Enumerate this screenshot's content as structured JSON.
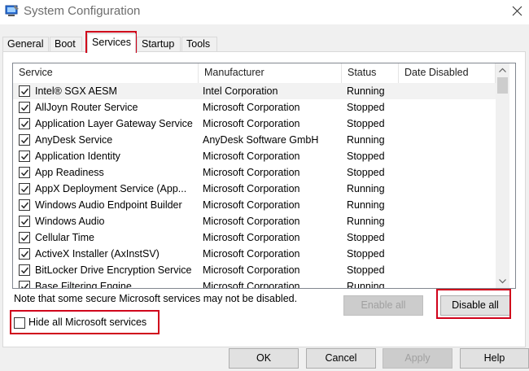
{
  "window": {
    "title": "System Configuration"
  },
  "tabs": [
    {
      "label": "General"
    },
    {
      "label": "Boot"
    },
    {
      "label": "Services",
      "selected": true
    },
    {
      "label": "Startup"
    },
    {
      "label": "Tools"
    }
  ],
  "list": {
    "columns": [
      "Service",
      "Manufacturer",
      "Status",
      "Date Disabled"
    ],
    "rows": [
      {
        "service": "Intel® SGX AESM",
        "manufacturer": "Intel Corporation",
        "status": "Running",
        "date_disabled": "",
        "checked": true
      },
      {
        "service": "AllJoyn Router Service",
        "manufacturer": "Microsoft Corporation",
        "status": "Stopped",
        "date_disabled": "",
        "checked": true
      },
      {
        "service": "Application Layer Gateway Service",
        "manufacturer": "Microsoft Corporation",
        "status": "Stopped",
        "date_disabled": "",
        "checked": true
      },
      {
        "service": "AnyDesk Service",
        "manufacturer": "AnyDesk Software GmbH",
        "status": "Running",
        "date_disabled": "",
        "checked": true
      },
      {
        "service": "Application Identity",
        "manufacturer": "Microsoft Corporation",
        "status": "Stopped",
        "date_disabled": "",
        "checked": true
      },
      {
        "service": "App Readiness",
        "manufacturer": "Microsoft Corporation",
        "status": "Stopped",
        "date_disabled": "",
        "checked": true
      },
      {
        "service": "AppX Deployment Service (App...",
        "manufacturer": "Microsoft Corporation",
        "status": "Running",
        "date_disabled": "",
        "checked": true
      },
      {
        "service": "Windows Audio Endpoint Builder",
        "manufacturer": "Microsoft Corporation",
        "status": "Running",
        "date_disabled": "",
        "checked": true
      },
      {
        "service": "Windows Audio",
        "manufacturer": "Microsoft Corporation",
        "status": "Running",
        "date_disabled": "",
        "checked": true
      },
      {
        "service": "Cellular Time",
        "manufacturer": "Microsoft Corporation",
        "status": "Stopped",
        "date_disabled": "",
        "checked": true
      },
      {
        "service": "ActiveX Installer (AxInstSV)",
        "manufacturer": "Microsoft Corporation",
        "status": "Stopped",
        "date_disabled": "",
        "checked": true
      },
      {
        "service": "BitLocker Drive Encryption Service",
        "manufacturer": "Microsoft Corporation",
        "status": "Stopped",
        "date_disabled": "",
        "checked": true
      },
      {
        "service": "Base Filtering Engine",
        "manufacturer": "Microsoft Corporation",
        "status": "Running",
        "date_disabled": "",
        "checked": true
      }
    ]
  },
  "note": "Note that some secure Microsoft services may not be disabled.",
  "buttons": {
    "enable_all": "Enable all",
    "disable_all": "Disable all",
    "ok": "OK",
    "cancel": "Cancel",
    "apply": "Apply",
    "help": "Help"
  },
  "hide_ms": {
    "label": "Hide all Microsoft services",
    "checked": false
  },
  "colors": {
    "highlight": "#d0021b",
    "panel": "#f0f0f0"
  },
  "icons": [
    "app-icon",
    "close-icon",
    "checkbox-checked-icon",
    "scroll-up-icon",
    "scroll-down-icon"
  ]
}
